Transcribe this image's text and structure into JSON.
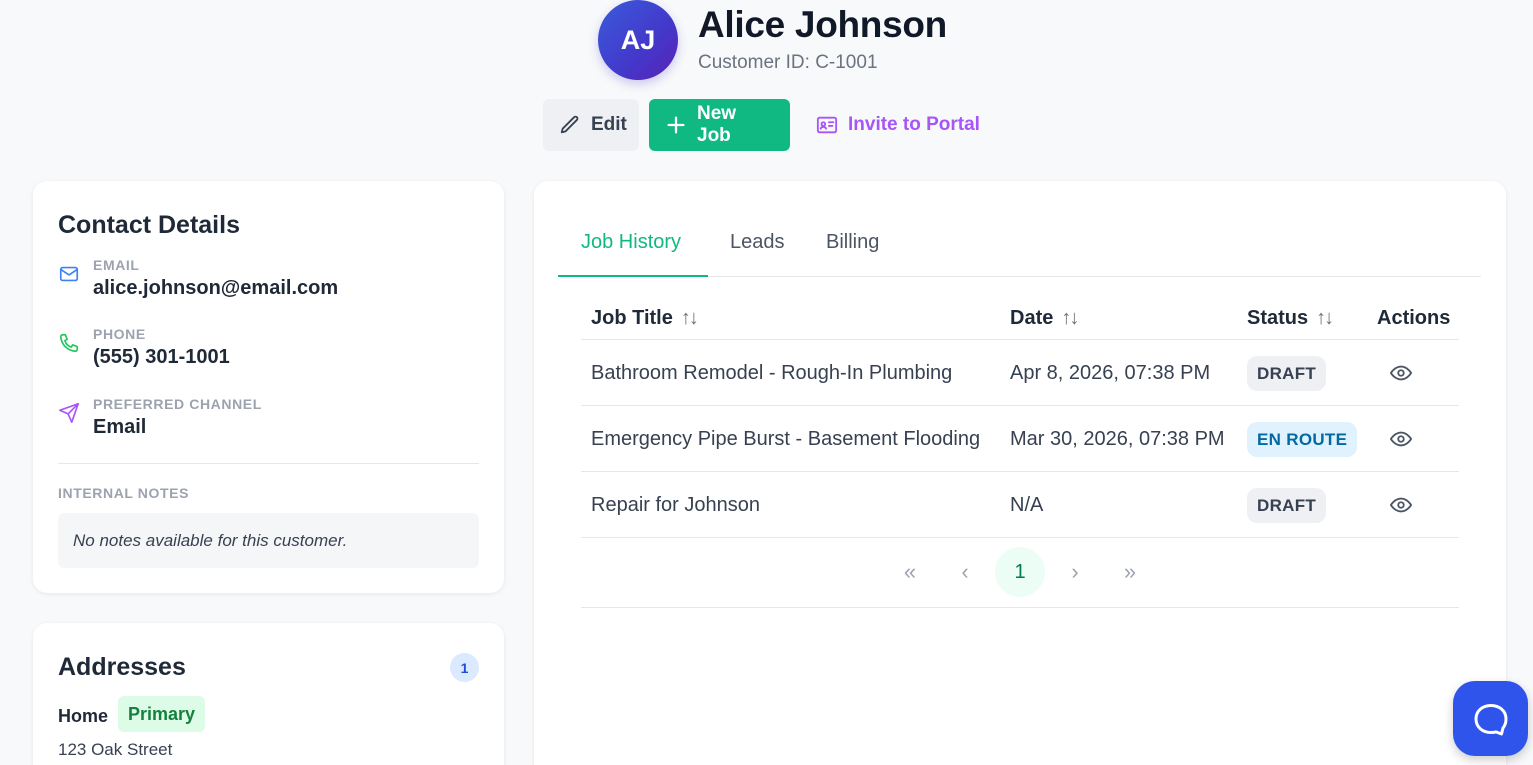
{
  "customer": {
    "initials": "AJ",
    "name": "Alice Johnson",
    "id_label": "Customer ID: C-1001"
  },
  "actions": {
    "edit_label": "Edit",
    "new_job_label": "New Job",
    "invite_label": "Invite to Portal"
  },
  "contact": {
    "title": "Contact Details",
    "email_label": "EMAIL",
    "email": "alice.johnson@email.com",
    "phone_label": "PHONE",
    "phone": "(555) 301-1001",
    "channel_label": "PREFERRED CHANNEL",
    "channel": "Email",
    "notes_label": "INTERNAL NOTES",
    "notes": "No notes available for this customer."
  },
  "addresses": {
    "title": "Addresses",
    "count": "1",
    "items": [
      {
        "type": "Home",
        "badge": "Primary",
        "line1": "123 Oak Street"
      }
    ]
  },
  "tabs": [
    {
      "label": "Job History",
      "active": true
    },
    {
      "label": "Leads",
      "active": false
    },
    {
      "label": "Billing",
      "active": false
    }
  ],
  "table": {
    "headers": [
      "Job Title",
      "Date",
      "Status",
      "Actions"
    ],
    "rows": [
      {
        "title": "Bathroom Remodel - Rough-In Plumbing",
        "date": "Apr 8, 2026, 07:38 PM",
        "status": "DRAFT"
      },
      {
        "title": "Emergency Pipe Burst - Basement Flooding",
        "date": "Mar 30, 2026, 07:38 PM",
        "status": "EN ROUTE"
      },
      {
        "title": "Repair for Johnson",
        "date": "N/A",
        "status": "DRAFT"
      }
    ]
  },
  "pagination": {
    "first": "«",
    "prev": "‹",
    "current": "1",
    "next": "›",
    "last": "»"
  },
  "colors": {
    "accent": "#10b981",
    "invite": "#a855f7",
    "help": "#2f54eb"
  }
}
